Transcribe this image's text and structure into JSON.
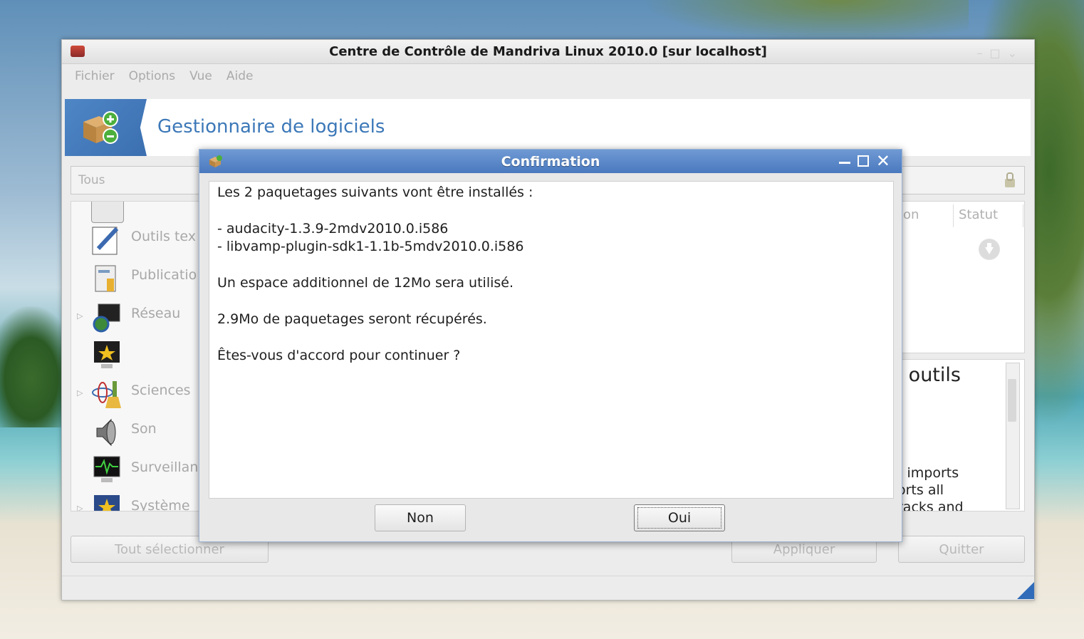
{
  "main_window": {
    "title": "Centre de Contrôle de Mandriva Linux 2010.0 [sur localhost]",
    "menu": [
      {
        "label": "Fichier"
      },
      {
        "label": "Options"
      },
      {
        "label": "Vue"
      },
      {
        "label": "Aide"
      }
    ],
    "banner_title": "Gestionnaire de logiciels",
    "search_placeholder": "Tous",
    "categories": [
      {
        "label": "Outils tex",
        "icon": "text-tools-icon"
      },
      {
        "label": "Publicatio",
        "icon": "publishing-icon"
      },
      {
        "label": "Réseau",
        "icon": "network-icon"
      },
      {
        "label": "",
        "icon": "star-monitor-icon"
      },
      {
        "label": "Sciences",
        "icon": "sciences-icon"
      },
      {
        "label": "Son",
        "icon": "speaker-icon"
      },
      {
        "label": "Surveillan",
        "icon": "monitoring-icon"
      },
      {
        "label": "Système",
        "icon": "system-icon"
      }
    ],
    "columns": {
      "partial": "on",
      "status": "Statut"
    },
    "description": {
      "title_fragment": "; outils",
      "lines": [
        "t imports",
        "orts all",
        "racks and"
      ]
    },
    "buttons": {
      "select_all": "Tout sélectionner",
      "apply": "Appliquer",
      "quit": "Quitter"
    }
  },
  "dialog": {
    "title": "Confirmation",
    "lines": [
      "Les 2 paquetages suivants vont être installés :",
      "- audacity-1.3.9-2mdv2010.0.i586",
      "- libvamp-plugin-sdk1-1.1b-5mdv2010.0.i586",
      "Un espace additionnel de 12Mo sera utilisé.",
      "2.9Mo de paquetages seront récupérés.",
      "Êtes-vous d'accord pour continuer ?"
    ],
    "buttons": {
      "no": "Non",
      "yes": "Oui"
    }
  }
}
